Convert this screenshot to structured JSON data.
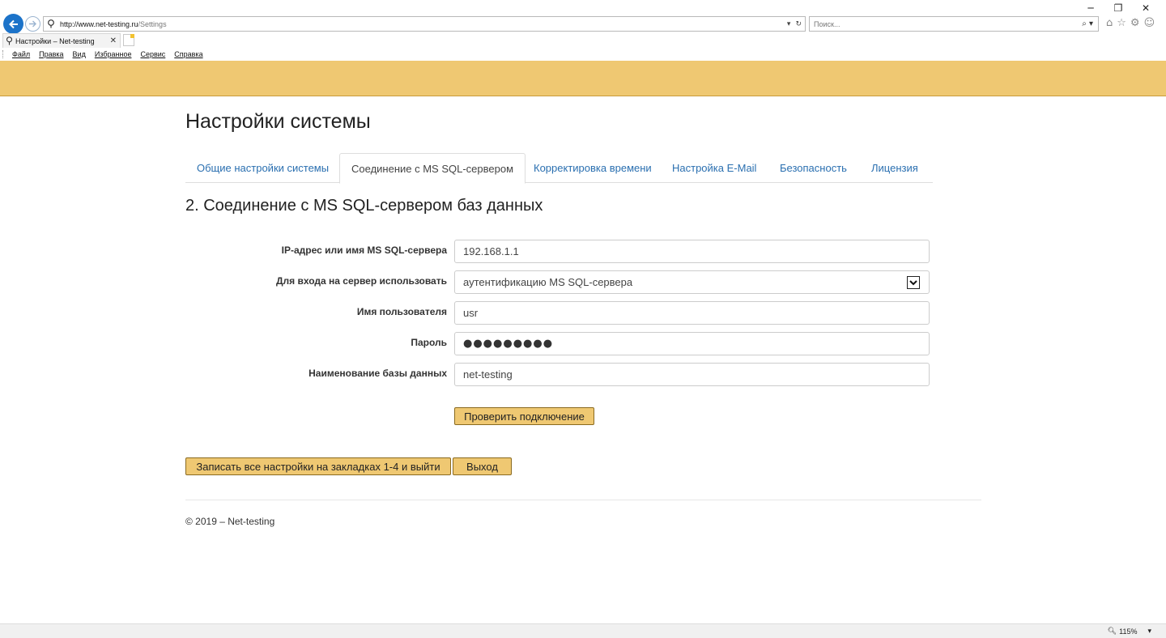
{
  "browser": {
    "url_host": "http://www.net-testing.ru",
    "url_path": "/Settings",
    "search_placeholder": "Поиск...",
    "tab_title": "Настройки – Net-testing",
    "menu": [
      "Файл",
      "Правка",
      "Вид",
      "Избранное",
      "Сервис",
      "Справка"
    ],
    "zoom": "115%"
  },
  "page": {
    "title": "Настройки системы",
    "tabs": [
      {
        "label": "Общие настройки системы",
        "active": false
      },
      {
        "label": "Соединение с MS SQL-сервером",
        "active": true
      },
      {
        "label": "Корректировка времени",
        "active": false
      },
      {
        "label": "Настройка E-Mail",
        "active": false
      },
      {
        "label": "Безопасность",
        "active": false
      },
      {
        "label": "Лицензия",
        "active": false
      }
    ],
    "section_title": "2. Соединение с MS SQL-сервером баз данных",
    "form": {
      "server_label": "IP-адрес или имя MS SQL-сервера",
      "server_value": "192.168.1.1",
      "auth_label": "Для входа на сервер использовать",
      "auth_value": "аутентификацию MS SQL-сервера",
      "user_label": "Имя пользователя",
      "user_value": "usr",
      "password_label": "Пароль",
      "password_value": "●●●●●●●●●",
      "db_label": "Наименование базы данных",
      "db_value": "net-testing"
    },
    "test_button": "Проверить подключение",
    "save_button": "Записать все настройки на закладках 1-4 и выйти",
    "exit_button": "Выход",
    "footer": "© 2019 – Net-testing"
  },
  "colors": {
    "header": "#efc872",
    "link": "#2a6fb0",
    "button_border": "#8a6a1f"
  }
}
